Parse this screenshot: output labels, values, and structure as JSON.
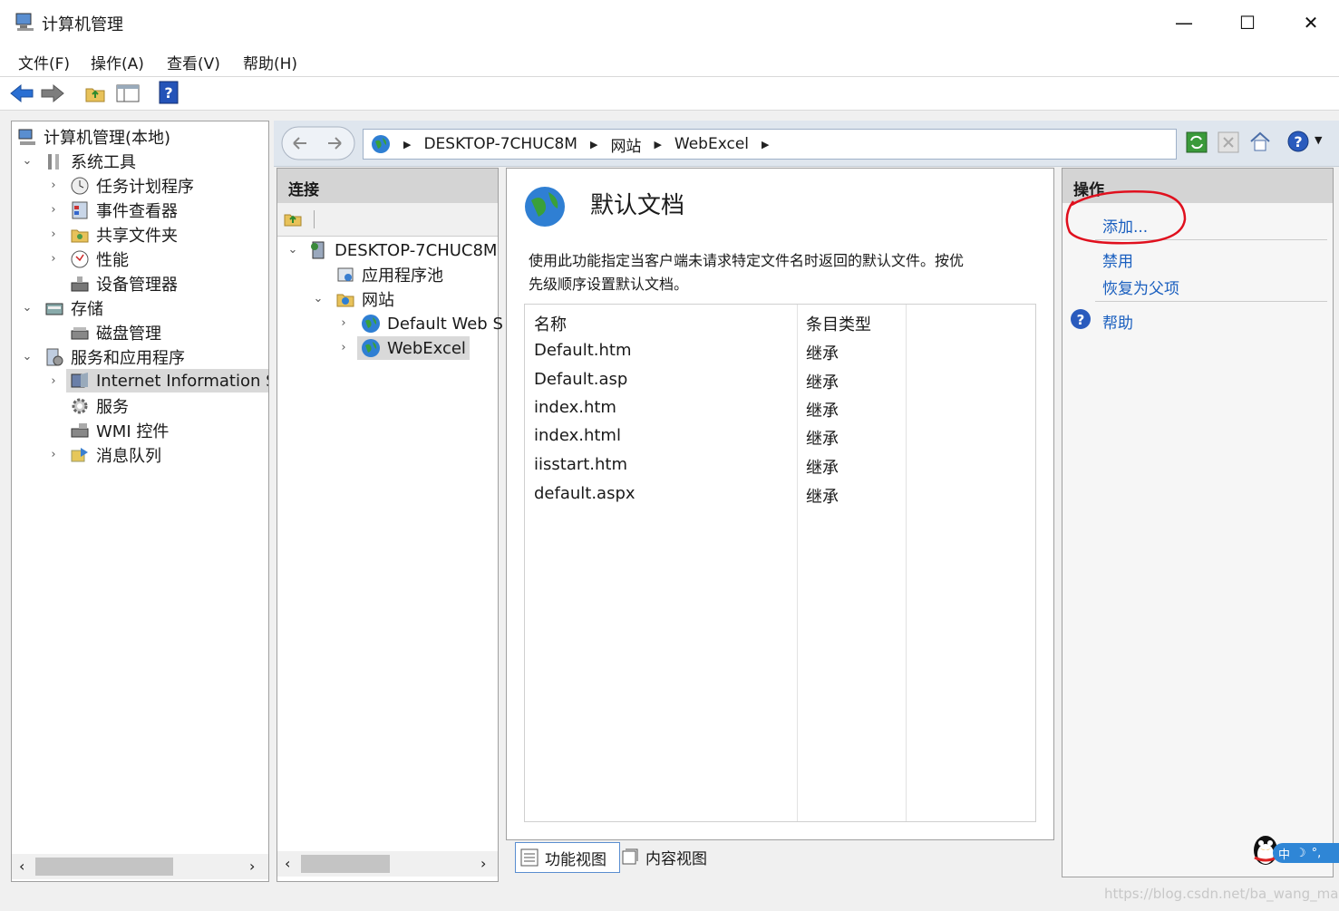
{
  "window": {
    "title": "计算机管理",
    "controls": {
      "minimize": "—",
      "maximize": "☐",
      "close": "✕"
    }
  },
  "menu": [
    "文件(F)",
    "操作(A)",
    "查看(V)",
    "帮助(H)"
  ],
  "left_tree": {
    "root": "计算机管理(本地)",
    "items": [
      {
        "label": "系统工具"
      },
      {
        "label": "任务计划程序"
      },
      {
        "label": "事件查看器"
      },
      {
        "label": "共享文件夹"
      },
      {
        "label": "性能"
      },
      {
        "label": "设备管理器"
      },
      {
        "label": "存储"
      },
      {
        "label": "磁盘管理"
      },
      {
        "label": "服务和应用程序"
      },
      {
        "label": "Internet Information Se"
      },
      {
        "label": "服务"
      },
      {
        "label": "WMI 控件"
      },
      {
        "label": "消息队列"
      }
    ]
  },
  "breadcrumb": [
    "DESKTOP-7CHUC8M",
    "网站",
    "WebExcel"
  ],
  "connections": {
    "title": "连接",
    "items": [
      "DESKTOP-7CHUC8M",
      "应用程序池",
      "网站",
      "Default Web S",
      "WebExcel"
    ]
  },
  "feature": {
    "title": "默认文档",
    "description_line1": "使用此功能指定当客户端未请求特定文件名时返回的默认文件。按优",
    "description_line2": "先级顺序设置默认文档。",
    "columns": [
      "名称",
      "条目类型"
    ],
    "rows": [
      {
        "name": "Default.htm",
        "type": "继承"
      },
      {
        "name": "Default.asp",
        "type": "继承"
      },
      {
        "name": "index.htm",
        "type": "继承"
      },
      {
        "name": "index.html",
        "type": "继承"
      },
      {
        "name": "iisstart.htm",
        "type": "继承"
      },
      {
        "name": "default.aspx",
        "type": "继承"
      }
    ]
  },
  "views": {
    "features": "功能视图",
    "content": "内容视图"
  },
  "actions": {
    "title": "操作",
    "items": [
      "添加...",
      "禁用",
      "恢复为父项",
      "帮助"
    ]
  },
  "ime": {
    "label": "中"
  },
  "watermark": "https://blog.csdn.net/ba_wang_mao",
  "colors": {
    "link": "#1a5fbf",
    "annotation": "#e0101e",
    "panel_header": "#d4d4d4"
  }
}
